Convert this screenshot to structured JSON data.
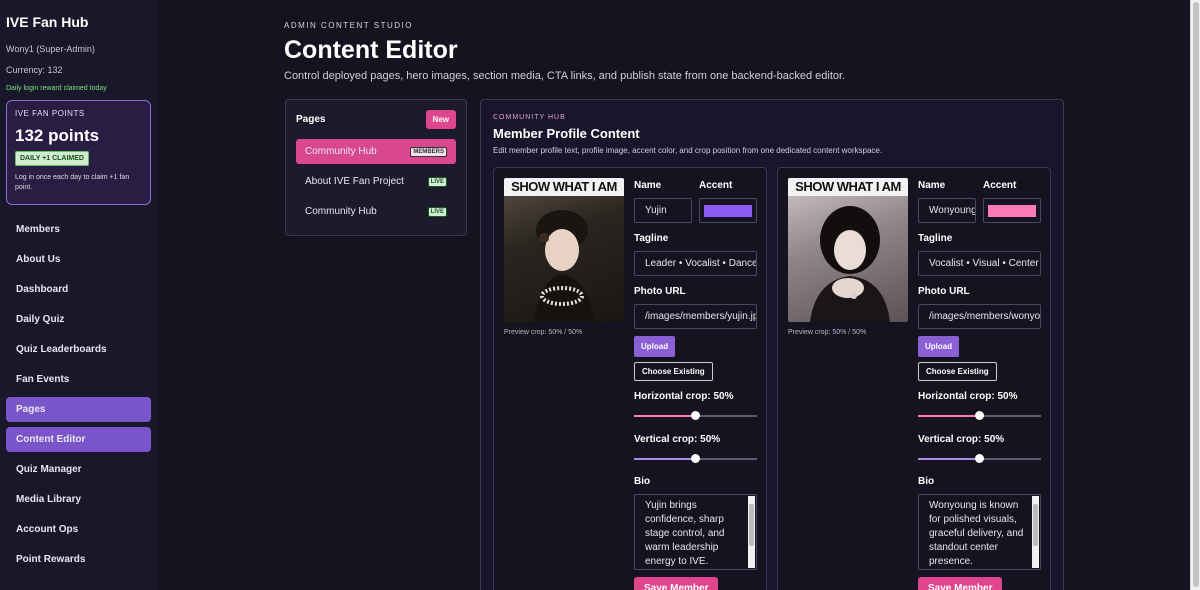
{
  "sidebar": {
    "brand": "IVE Fan Hub",
    "user": "Wony1 (Super-Admin)",
    "currency": "Currency: 132",
    "reward_note": "Daily login reward claimed today",
    "points_card": {
      "label": "IVE FAN POINTS",
      "value": "132 points",
      "badge": "DAILY +1 CLAIMED",
      "desc": "Log in once each day to claim +1 fan point."
    },
    "items": [
      {
        "label": "Members",
        "active": false
      },
      {
        "label": "About Us",
        "active": false
      },
      {
        "label": "Dashboard",
        "active": false
      },
      {
        "label": "Daily Quiz",
        "active": false
      },
      {
        "label": "Quiz Leaderboards",
        "active": false
      },
      {
        "label": "Fan Events",
        "active": false
      },
      {
        "label": "Pages",
        "active": true
      },
      {
        "label": "Content Editor",
        "active": true
      },
      {
        "label": "Quiz Manager",
        "active": false
      },
      {
        "label": "Media Library",
        "active": false
      },
      {
        "label": "Account Ops",
        "active": false
      },
      {
        "label": "Point Rewards",
        "active": false
      }
    ]
  },
  "header": {
    "eyebrow": "ADMIN CONTENT STUDIO",
    "title": "Content Editor",
    "subtitle": "Control deployed pages, hero images, section media, CTA links, and publish state from one backend-backed editor."
  },
  "pages_panel": {
    "title": "Pages",
    "new_label": "New",
    "rows": [
      {
        "label": "Community Hub",
        "tag": "MEMBERS",
        "active": true
      },
      {
        "label": "About IVE Fan Project",
        "tag": "LIVE",
        "active": false
      },
      {
        "label": "Community Hub",
        "tag": "LIVE",
        "active": false
      }
    ]
  },
  "editor": {
    "eyebrow": "COMMUNITY HUB",
    "title": "Member Profile Content",
    "desc": "Edit member profile text, profile image, accent color, and crop position from one dedicated content workspace.",
    "labels": {
      "name": "Name",
      "accent": "Accent",
      "tagline": "Tagline",
      "photo_url": "Photo URL",
      "upload": "Upload",
      "choose_existing": "Choose Existing",
      "bio": "Bio",
      "save": "Save Member"
    },
    "members": [
      {
        "photo_banner": "SHOW WHAT I AM",
        "crop_preview": "Preview crop: 50% / 50%",
        "name": "Yujin",
        "accent": "#8b5cf6",
        "tagline": "Leader • Vocalist • Dancer",
        "photo_url": "/images/members/yujin.jpg",
        "h_crop_label": "Horizontal crop: 50%",
        "v_crop_label": "Vertical crop: 50%",
        "h_crop": 0.5,
        "v_crop": 0.5,
        "bio": "Yujin brings confidence, sharp stage control, and warm leadership energy to IVE."
      },
      {
        "photo_banner": "SHOW WHAT I AM",
        "crop_preview": "Preview crop: 50% / 50%",
        "name": "Wonyoung",
        "accent": "#ff7ab8",
        "tagline": "Vocalist • Visual • Center",
        "photo_url": "/images/members/wonyoung.jpg",
        "h_crop_label": "Horizontal crop: 50%",
        "v_crop_label": "Vertical crop: 50%",
        "h_crop": 0.5,
        "v_crop": 0.5,
        "bio": "Wonyoung is known for polished visuals, graceful delivery, and standout center presence."
      }
    ]
  },
  "colors": {
    "pink": "#e0468e",
    "purple": "#7a55c9",
    "live_tag": "#cff0d3"
  }
}
